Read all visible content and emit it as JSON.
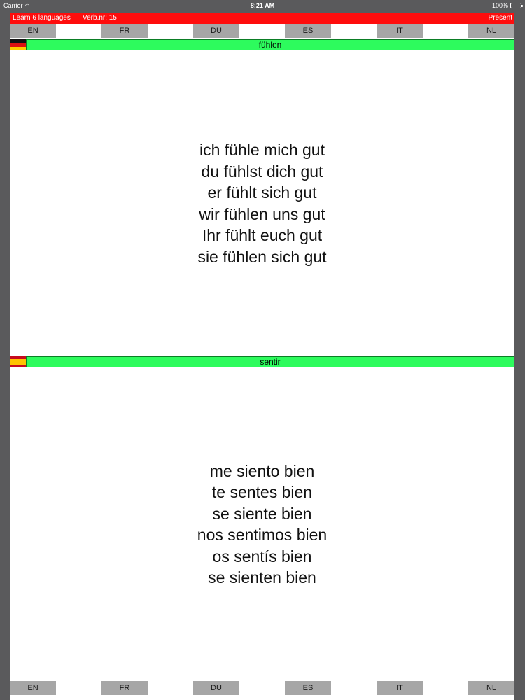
{
  "status_bar": {
    "carrier": "Carrier",
    "time": "8:21 AM",
    "battery": "100%"
  },
  "top_bar": {
    "app_title": "Learn 6 languages",
    "verb_nr": "Verb.nr: 15",
    "tense": "Present",
    "color": "#ff0d0d"
  },
  "languages": [
    "EN",
    "FR",
    "DU",
    "ES",
    "IT",
    "NL"
  ],
  "panels": [
    {
      "flag": "german-flag-icon",
      "verb": "fühlen",
      "lines": [
        "ich fühle mich gut",
        "du fühlst dich gut",
        "er fühlt sich gut",
        "wir fühlen uns gut",
        "Ihr fühlt euch gut",
        "sie fühlen sich gut"
      ]
    },
    {
      "flag": "spanish-flag-icon",
      "verb": "sentir",
      "lines": [
        "me siento bien",
        "te sentes bien",
        "se siente bien",
        "nos sentimos bien",
        "os sentís bien",
        "se sienten bien"
      ]
    }
  ],
  "colors": {
    "verb_bar": "#2dfb5d",
    "lang_button": "#a6a6a6",
    "frame": "#5a5a5c"
  }
}
